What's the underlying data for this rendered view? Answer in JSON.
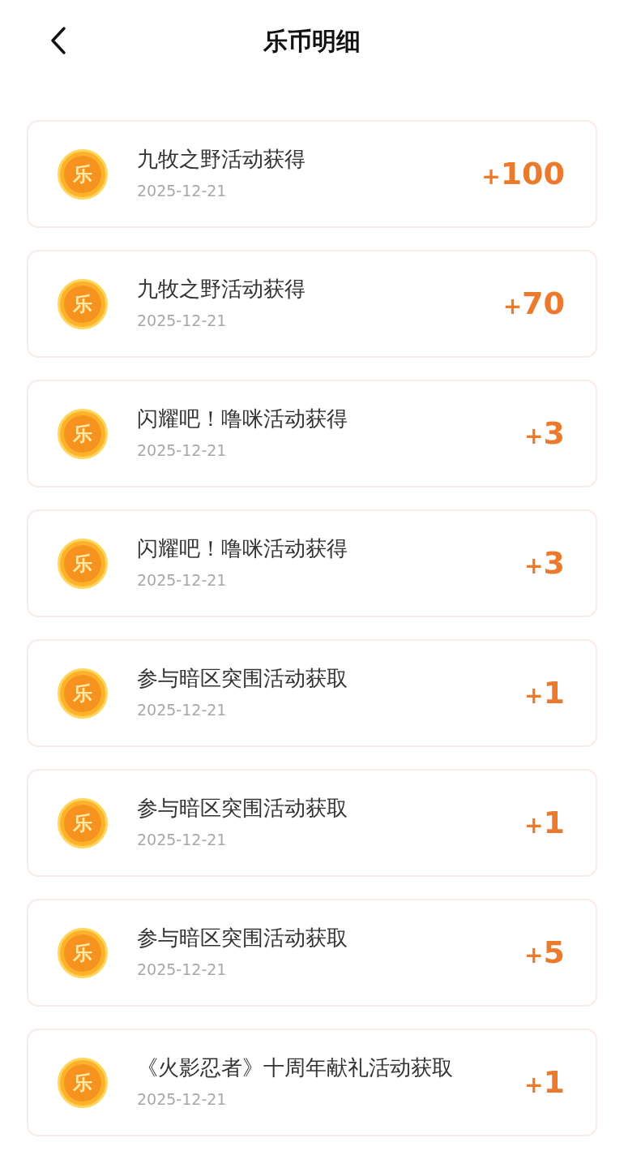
{
  "header": {
    "title": "乐币明细"
  },
  "records": [
    {
      "coin": "乐",
      "title": "九牧之野活动获得",
      "date": "2025-12-21",
      "sign": "+",
      "amount": "100"
    },
    {
      "coin": "乐",
      "title": "九牧之野活动获得",
      "date": "2025-12-21",
      "sign": "+",
      "amount": "70"
    },
    {
      "coin": "乐",
      "title": "闪耀吧！噜咪活动获得",
      "date": "2025-12-21",
      "sign": "+",
      "amount": "3"
    },
    {
      "coin": "乐",
      "title": "闪耀吧！噜咪活动获得",
      "date": "2025-12-21",
      "sign": "+",
      "amount": "3"
    },
    {
      "coin": "乐",
      "title": "参与暗区突围活动获取",
      "date": "2025-12-21",
      "sign": "+",
      "amount": "1"
    },
    {
      "coin": "乐",
      "title": "参与暗区突围活动获取",
      "date": "2025-12-21",
      "sign": "+",
      "amount": "1"
    },
    {
      "coin": "乐",
      "title": "参与暗区突围活动获取",
      "date": "2025-12-21",
      "sign": "+",
      "amount": "5"
    },
    {
      "coin": "乐",
      "title": "《火影忍者》十周年献礼活动获取",
      "date": "2025-12-21",
      "sign": "+",
      "amount": "1"
    }
  ]
}
